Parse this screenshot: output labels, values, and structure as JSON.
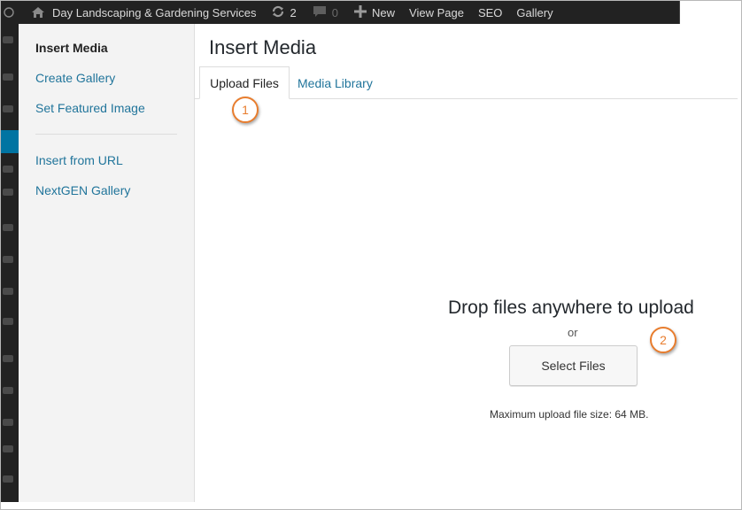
{
  "adminbar": {
    "site_name": "Day Landscaping & Gardening Services",
    "updates_count": "2",
    "comments_count": "0",
    "new_label": "New",
    "view_page_label": "View Page",
    "seo_label": "SEO",
    "gallery_label": "Gallery",
    "icons": [
      "wordpress-icon",
      "house-icon",
      "updates-icon",
      "comments-icon",
      "plus-icon"
    ]
  },
  "modal": {
    "title": "Insert Media",
    "menu": {
      "items": [
        {
          "label": "Insert Media",
          "current": true
        },
        {
          "label": "Create Gallery",
          "current": false
        },
        {
          "label": "Set Featured Image",
          "current": false
        },
        {
          "label": "Insert from URL",
          "current": false
        },
        {
          "label": "NextGEN Gallery",
          "current": false
        }
      ]
    },
    "tabs": [
      {
        "label": "Upload Files",
        "active": true
      },
      {
        "label": "Media Library",
        "active": false
      }
    ],
    "upload": {
      "drop_text": "Drop files anywhere to upload",
      "or_text": "or",
      "button_label": "Select Files",
      "max_size_text": "Maximum upload file size: 64 MB."
    }
  },
  "callouts": [
    "1",
    "2"
  ],
  "colors": {
    "adminbar_bg": "#222222",
    "link": "#21759b",
    "callout": "#e87d2e",
    "menu_bg": "#f3f3f3"
  }
}
